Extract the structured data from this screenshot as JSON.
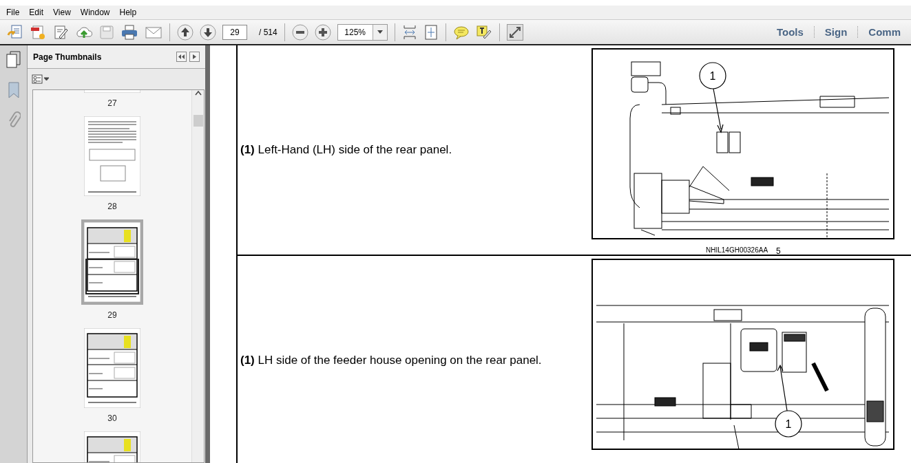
{
  "menu": [
    "File",
    "Edit",
    "View",
    "Window",
    "Help"
  ],
  "toolbar": {
    "page_number": "29",
    "page_total": "/ 514",
    "zoom": "125%",
    "links": [
      "Tools",
      "Sign",
      "Comm"
    ]
  },
  "sidebar": {
    "title": "Page Thumbnails",
    "thumbnails": [
      {
        "label": "27",
        "selected": false,
        "kind": "cut"
      },
      {
        "label": "28",
        "selected": false,
        "kind": "text"
      },
      {
        "label": "29",
        "selected": true,
        "kind": "table"
      },
      {
        "label": "30",
        "selected": false,
        "kind": "table"
      },
      {
        "selected": false,
        "kind": "table"
      }
    ]
  },
  "document": {
    "rows": [
      {
        "text": "**(1)** Left-Hand (LH) side of the rear panel.",
        "callout": "1",
        "caption": "NHIL14GH00326AA",
        "figure_number": "5",
        "kind": "side"
      },
      {
        "text": "**(1)** LH side of the feeder house opening on the rear panel.",
        "callout": "1",
        "kind": "feeder"
      }
    ]
  }
}
